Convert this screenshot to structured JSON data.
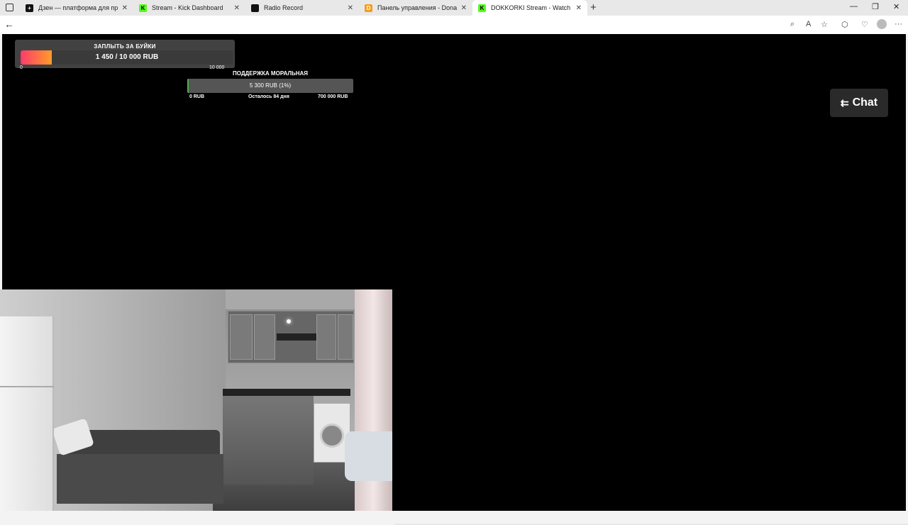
{
  "browser": {
    "tabs": [
      {
        "title": "Дзен — платформа для просмотра",
        "favicon": "plus-circle-icon"
      },
      {
        "title": "Stream - Kick Dashboard",
        "favicon": "kick-icon"
      },
      {
        "title": "Radio Record",
        "favicon": "radio-record-icon"
      },
      {
        "title": "Панель управления - DonationAlerts",
        "favicon": "donationalerts-icon"
      },
      {
        "title": "DOKKORKI Stream - Watch Live on Kick",
        "favicon": "kick-icon",
        "active": true
      }
    ],
    "close_glyph": "✕",
    "new_tab_glyph": "+",
    "minimize_glyph": "—",
    "restore_glyph": "❐",
    "window_close_glyph": "✕",
    "back_glyph": "←",
    "menu_glyph": "···",
    "colors": {
      "kick_green": "#53fc18",
      "chrome_bg": "#e8e8e8"
    }
  },
  "overlay": {
    "goal1": {
      "title": "ЗАПЛЫТЬ ЗА БУЙКИ",
      "progress_text": "1 450 / 10 000 RUB",
      "min_label": "0",
      "max_label": "10 000",
      "progress_fraction": 0.145
    },
    "goal2": {
      "title": "ПОДДЕРЖКА МОРАЛЬНАЯ",
      "progress_text": "5 300 RUB (1%)",
      "min_label": "0 RUB",
      "remaining_label": "Осталось 84 дня",
      "max_label": "700 000 RUB",
      "progress_fraction": 0.01
    }
  },
  "chat_button": {
    "label": "Chat",
    "icon": "collapse-left-arrow-icon"
  }
}
